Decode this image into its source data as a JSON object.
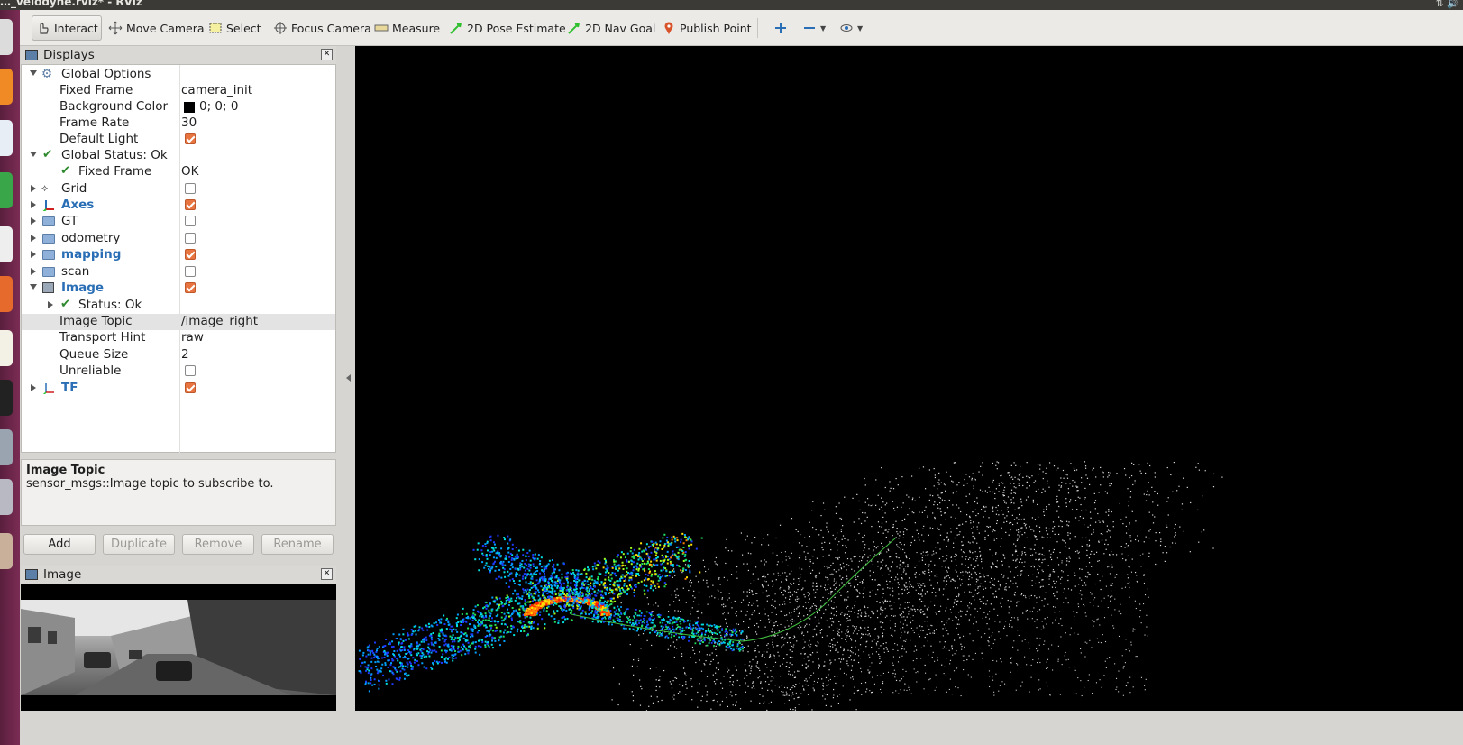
{
  "window": {
    "title": "…_velodyne.rviz* - RViz"
  },
  "toolbar": {
    "interact": "Interact",
    "move_camera": "Move Camera",
    "select": "Select",
    "focus_camera": "Focus Camera",
    "measure": "Measure",
    "pose_estimate": "2D Pose Estimate",
    "nav_goal": "2D Nav Goal",
    "publish_point": "Publish Point"
  },
  "displays": {
    "title": "Displays",
    "global_options": "Global Options",
    "fixed_frame_label": "Fixed Frame",
    "fixed_frame_value": "camera_init",
    "bg_color_label": "Background Color",
    "bg_color_value": "0; 0; 0",
    "frame_rate_label": "Frame Rate",
    "frame_rate_value": "30",
    "default_light_label": "Default Light",
    "global_status": "Global Status: Ok",
    "gs_fixed_frame": "Fixed Frame",
    "gs_fixed_frame_value": "OK",
    "grid": "Grid",
    "axes": "Axes",
    "gt": "GT",
    "odometry": "odometry",
    "mapping": "mapping",
    "scan": "scan",
    "image": "Image",
    "image_status": "Status: Ok",
    "image_topic_label": "Image Topic",
    "image_topic_value": "/image_right",
    "transport_hint_label": "Transport Hint",
    "transport_hint_value": "raw",
    "queue_size_label": "Queue Size",
    "queue_size_value": "2",
    "unreliable_label": "Unreliable",
    "tf": "TF"
  },
  "description": {
    "title": "Image Topic",
    "text": "sensor_msgs::Image topic to subscribe to."
  },
  "buttons": {
    "add": "Add",
    "duplicate": "Duplicate",
    "remove": "Remove",
    "rename": "Rename"
  },
  "image_panel": {
    "title": "Image"
  },
  "colors": {
    "accent_checkbox": "#e8743f",
    "viewport_bg": "#000000",
    "link_blue": "#2a6fb6"
  }
}
